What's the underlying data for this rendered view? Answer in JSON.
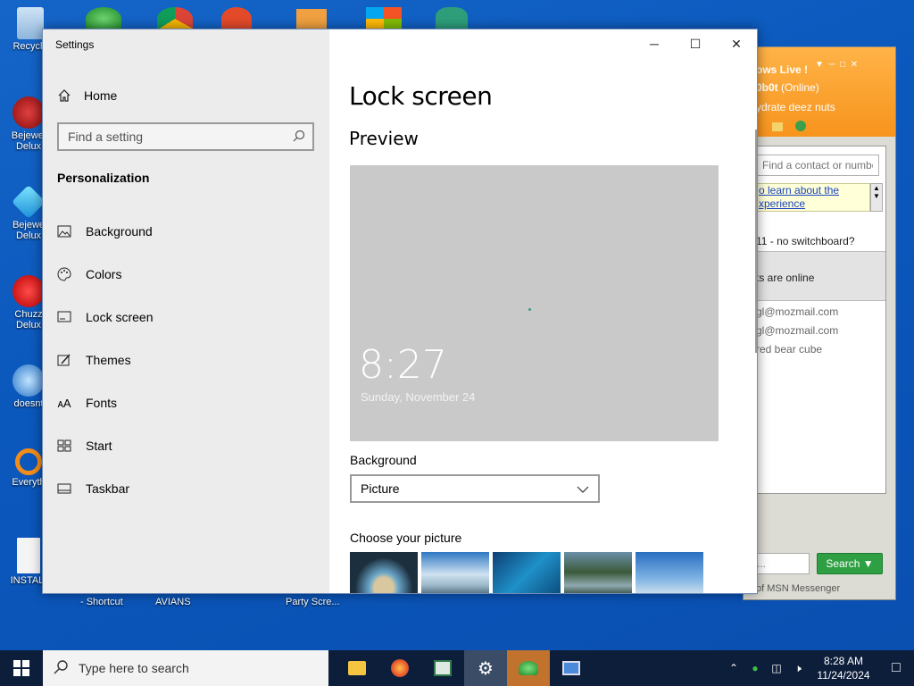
{
  "desktop": {
    "icons": [
      {
        "label": "Recycle"
      },
      {
        "label": "Bejewel Delux"
      },
      {
        "label": "Bejewe Delux"
      },
      {
        "label": "Chuzz Delux"
      },
      {
        "label": "doesnt"
      },
      {
        "label": "Everyth"
      },
      {
        "label": "INSTALI"
      }
    ],
    "bottom_labels": [
      "- Shortcut",
      "AVIANS",
      "Party Scre..."
    ]
  },
  "messenger": {
    "title": "ows Live !",
    "user": "0b0t",
    "status": "(Online)",
    "personal_message": "ydrate deez nuts",
    "find_placeholder": "Find a contact or number",
    "banner_line1": "o learn about the",
    "banner_line2": "xperience",
    "line_switchboard": "11 - no switchboard?",
    "line_online": "ts are online",
    "contacts": [
      "gl@mozmail.com",
      "gl@mozmail.com",
      "red bear cube"
    ],
    "search_placeholder": "...",
    "search_button": "Search",
    "footer": "of MSN Messenger",
    "accent": "#f7941d"
  },
  "settings": {
    "window_title": "Settings",
    "home_label": "Home",
    "search_placeholder": "Find a setting",
    "section": "Personalization",
    "nav": [
      {
        "label": "Background",
        "icon": "picture-icon"
      },
      {
        "label": "Colors",
        "icon": "palette-icon"
      },
      {
        "label": "Lock screen",
        "icon": "lock-screen-icon"
      },
      {
        "label": "Themes",
        "icon": "brush-icon"
      },
      {
        "label": "Fonts",
        "icon": "font-icon"
      },
      {
        "label": "Start",
        "icon": "start-icon"
      },
      {
        "label": "Taskbar",
        "icon": "taskbar-icon"
      }
    ],
    "page_title": "Lock screen",
    "preview_heading": "Preview",
    "preview_time": "8:27",
    "preview_date": "Sunday, November 24",
    "background_label": "Background",
    "background_value": "Picture",
    "choose_picture_label": "Choose your picture"
  },
  "taskbar": {
    "search_placeholder": "Type here to search",
    "time": "8:28 AM",
    "date": "11/24/2024"
  }
}
